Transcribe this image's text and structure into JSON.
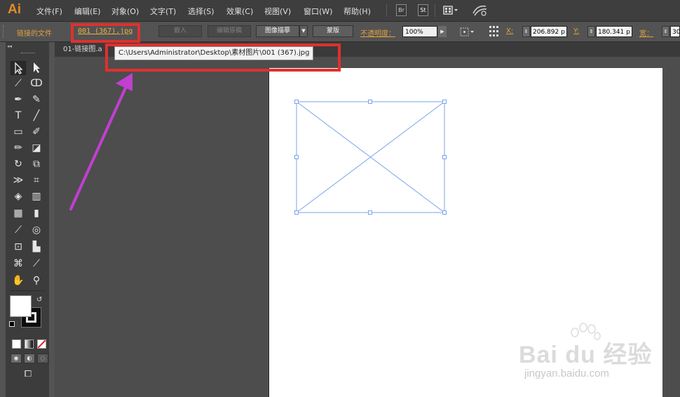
{
  "app": {
    "logo": "Ai"
  },
  "menu": [
    "文件(F)",
    "编辑(E)",
    "对象(O)",
    "文字(T)",
    "选择(S)",
    "效果(C)",
    "视图(V)",
    "窗口(W)",
    "帮助(H)"
  ],
  "menubar_icons": {
    "bridge": "Br",
    "stock": "St",
    "arrange": "arrange-documents-icon",
    "gpu": "gpu-performance-icon"
  },
  "control_bar": {
    "linked_file_label": "链接的文件",
    "file_name": "001 (367).jpg",
    "embed_button": "嵌入",
    "edit_original_button": "编辑原稿",
    "image_trace_button": "图像描摹",
    "mask_button": "蒙版",
    "opacity_label": "不透明度：",
    "opacity_value": "100%",
    "x_label": "X:",
    "x_value": "206.892 p",
    "y_label": "Y:",
    "y_value": "180.341 p",
    "w_label": "宽：",
    "w_value": "30"
  },
  "document": {
    "tab_label": "01-链接图.a",
    "path_tooltip": "C:\\Users\\Administrator\\Desktop\\素材图片\\001 (367).jpg"
  },
  "colors": {
    "annotation_red": "#e0302d",
    "annotation_arrow": "#c040d0",
    "selection_blue": "#7aa3ea",
    "link_orange": "#f0b040"
  },
  "watermark": {
    "logo": "Bai du 经验",
    "url": "jingyan.baidu.com"
  }
}
